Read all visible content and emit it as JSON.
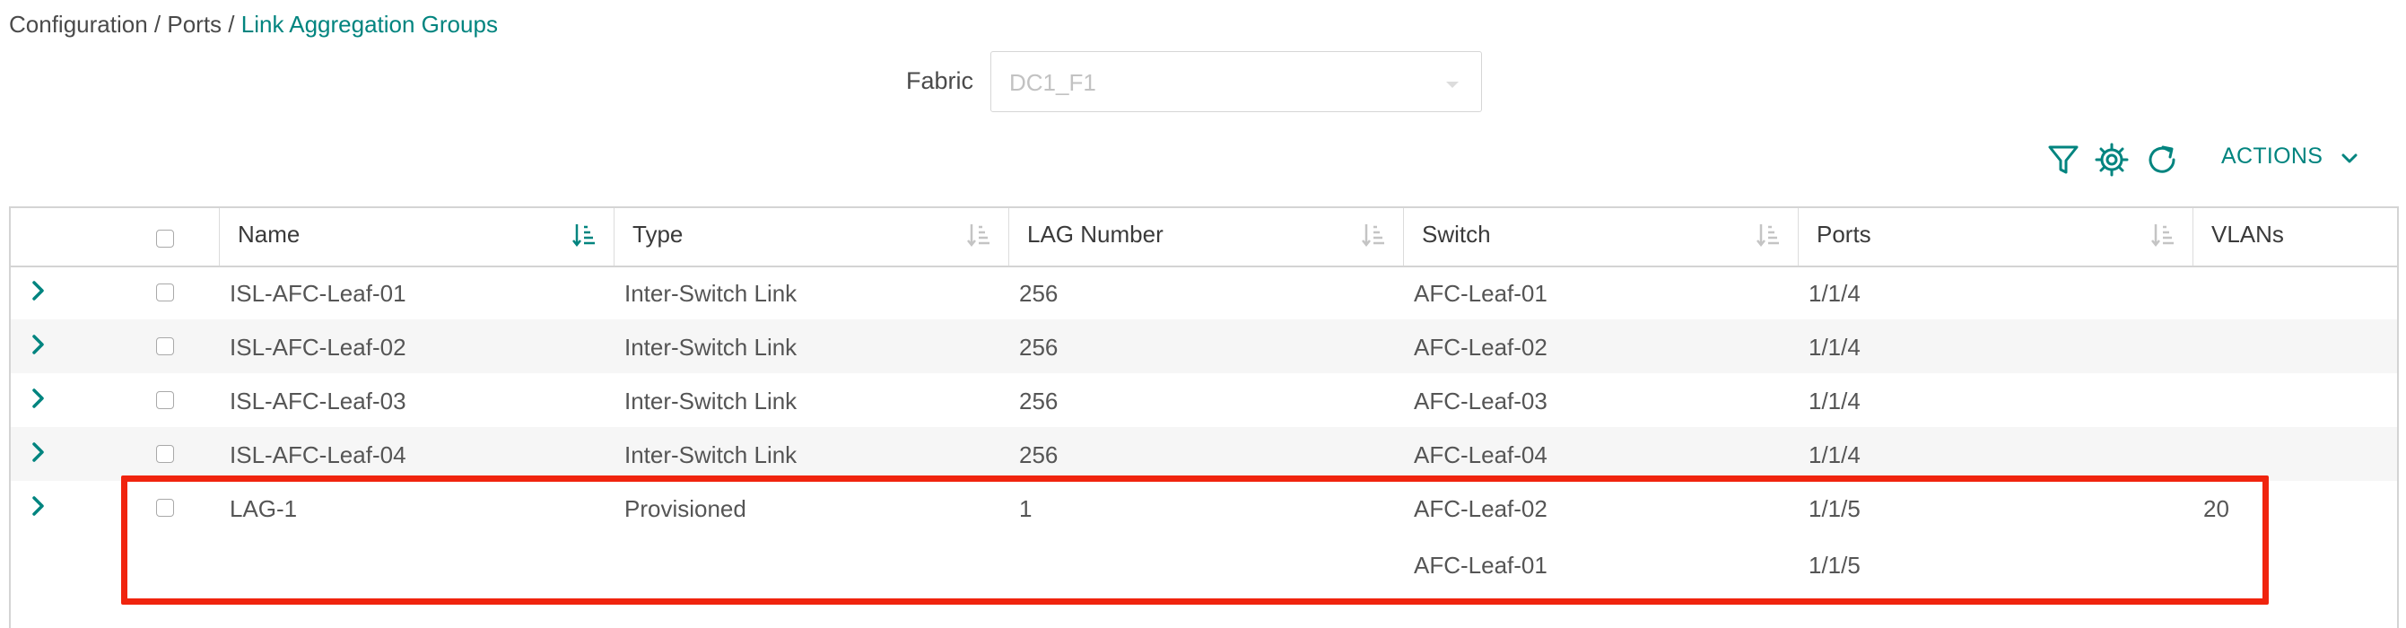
{
  "breadcrumb": {
    "items": [
      "Configuration",
      "Ports"
    ],
    "current": "Link Aggregation Groups",
    "separator": "/"
  },
  "fabric": {
    "label": "Fabric",
    "value": "DC1_F1"
  },
  "toolbar": {
    "actions_label": "ACTIONS",
    "icons": [
      "filter-icon",
      "settings-gear-icon",
      "refresh-icon"
    ]
  },
  "colors": {
    "accent": "#01847f",
    "highlight": "#f0240e",
    "row_alt": "#f6f6f6"
  },
  "table": {
    "columns": [
      "Name",
      "Type",
      "LAG Number",
      "Switch",
      "Ports",
      "VLANs"
    ],
    "rows": [
      {
        "name": "ISL-AFC-Leaf-01",
        "type": "Inter-Switch Link",
        "lag": "256",
        "switch": "AFC-Leaf-01",
        "ports": "1/1/4",
        "vlans": ""
      },
      {
        "name": "ISL-AFC-Leaf-02",
        "type": "Inter-Switch Link",
        "lag": "256",
        "switch": "AFC-Leaf-02",
        "ports": "1/1/4",
        "vlans": ""
      },
      {
        "name": "ISL-AFC-Leaf-03",
        "type": "Inter-Switch Link",
        "lag": "256",
        "switch": "AFC-Leaf-03",
        "ports": "1/1/4",
        "vlans": ""
      },
      {
        "name": "ISL-AFC-Leaf-04",
        "type": "Inter-Switch Link",
        "lag": "256",
        "switch": "AFC-Leaf-04",
        "ports": "1/1/4",
        "vlans": ""
      },
      {
        "name": "LAG-1",
        "type": "Provisioned",
        "lag": "1",
        "switch": "AFC-Leaf-02",
        "ports": "1/1/5",
        "vlans": "20",
        "extra": {
          "switch": "AFC-Leaf-01",
          "ports": "1/1/5"
        }
      }
    ]
  }
}
